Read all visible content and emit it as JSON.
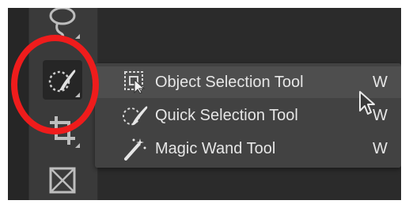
{
  "toolbar": {
    "tools": [
      {
        "name": "lasso-tool",
        "icon": "lasso-icon",
        "active": false
      },
      {
        "name": "quick-selection-tool",
        "icon": "quick-selection-brush-icon",
        "active": true
      },
      {
        "name": "crop-tool",
        "icon": "crop-icon",
        "active": false
      },
      {
        "name": "frame-tool",
        "icon": "frame-icon",
        "active": false
      }
    ]
  },
  "flyout": {
    "items": [
      {
        "label": "Object Selection Tool",
        "shortcut": "W",
        "icon": "object-selection-icon",
        "selected": true
      },
      {
        "label": "Quick Selection Tool",
        "shortcut": "W",
        "icon": "quick-selection-icon",
        "selected": false
      },
      {
        "label": "Magic Wand Tool",
        "shortcut": "W",
        "icon": "magic-wand-icon",
        "selected": false
      }
    ]
  },
  "colors": {
    "panel_background": "#2b2b2b",
    "toolbar_background": "#3a3a3a",
    "menu_background": "#424242",
    "menu_hover": "#4e4e4e",
    "menu_text": "#e6e6e6",
    "highlight_ring": "#ef1c1c"
  },
  "annotation": {
    "highlight": "red-circle",
    "pointer": "arrow-cursor-icon"
  }
}
